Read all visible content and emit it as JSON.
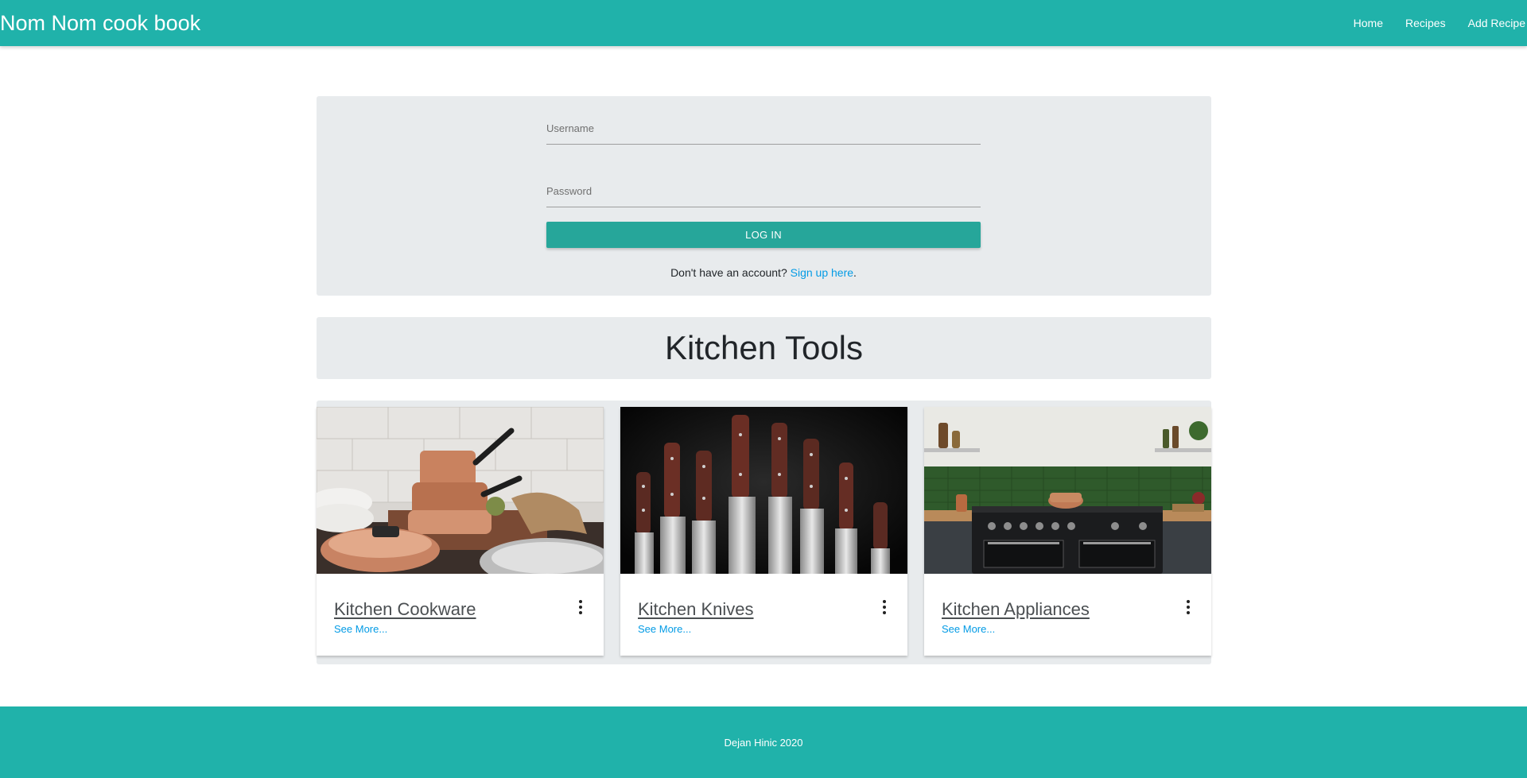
{
  "navbar": {
    "brand": "Nom Nom cook book",
    "links": [
      "Home",
      "Recipes",
      "Add Recipe"
    ]
  },
  "login": {
    "username_placeholder": "Username",
    "password_placeholder": "Password",
    "button_label": "LOG IN",
    "signup_prompt": "Don't have an account?",
    "signup_link": "Sign up here",
    "signup_suffix": "."
  },
  "section": {
    "title": "Kitchen Tools"
  },
  "cards": [
    {
      "title": "Kitchen Cookware",
      "link": "See More...",
      "image": "copper-cookware-photo"
    },
    {
      "title": "Kitchen Knives",
      "link": "See More...",
      "image": "knife-set-photo"
    },
    {
      "title": "Kitchen Appliances",
      "link": "See More...",
      "image": "kitchen-range-photo"
    }
  ],
  "footer": {
    "text": "Dejan Hinic 2020"
  },
  "colors": {
    "primary": "#20b2aa",
    "button": "#26a69a",
    "panel": "#e8ebed",
    "link": "#039be5"
  }
}
